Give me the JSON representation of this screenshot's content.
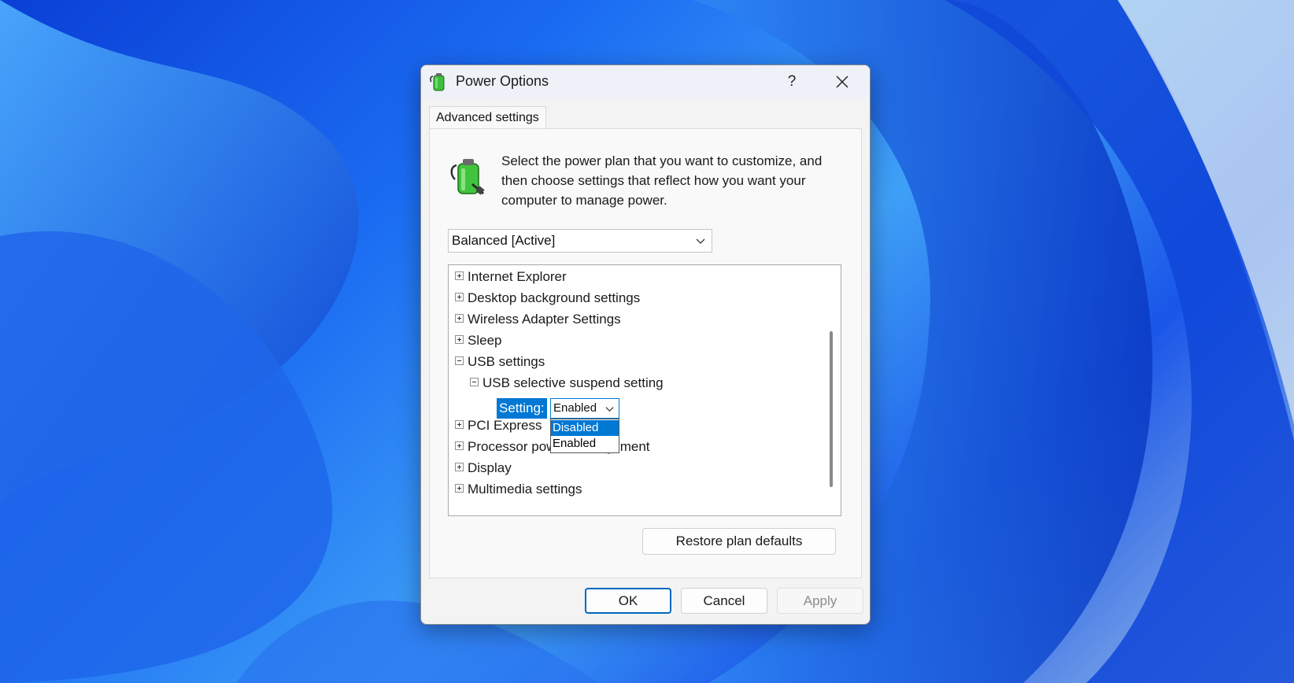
{
  "window": {
    "title": "Power Options",
    "help_label": "?",
    "icons": {
      "app": "power-options-icon",
      "close": "close-icon"
    }
  },
  "tab": {
    "label": "Advanced settings"
  },
  "description": "Select the power plan that you want to customize, and then choose settings that reflect how you want your computer to manage power.",
  "plan_select": {
    "value": "Balanced [Active]"
  },
  "tree": {
    "items": [
      {
        "label": "Internet Explorer",
        "state": "collapsed"
      },
      {
        "label": "Desktop background settings",
        "state": "collapsed"
      },
      {
        "label": "Wireless Adapter Settings",
        "state": "collapsed"
      },
      {
        "label": "Sleep",
        "state": "collapsed"
      },
      {
        "label": "USB settings",
        "state": "expanded"
      },
      {
        "label": "USB selective suspend setting",
        "state": "expanded"
      },
      {
        "label": "PCI Express",
        "state": "collapsed"
      },
      {
        "label": "Processor power management",
        "state": "collapsed"
      },
      {
        "label": "Display",
        "state": "collapsed"
      },
      {
        "label": "Multimedia settings",
        "state": "collapsed"
      }
    ],
    "setting": {
      "label": "Setting:",
      "value": "Enabled",
      "options": [
        "Disabled",
        "Enabled"
      ],
      "highlighted": "Disabled"
    }
  },
  "buttons": {
    "restore": "Restore plan defaults",
    "ok": "OK",
    "cancel": "Cancel",
    "apply": "Apply"
  },
  "colors": {
    "accent": "#0078d4",
    "dialog_bg": "#f3f3f3",
    "disabled_text": "#8c8c8c"
  }
}
